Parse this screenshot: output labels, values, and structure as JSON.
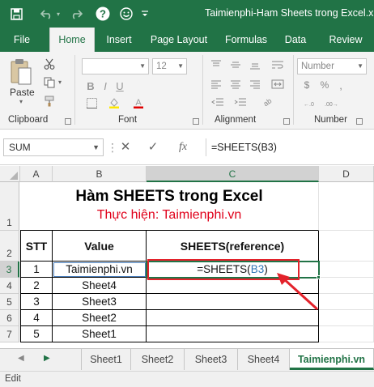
{
  "window": {
    "title": "Taimienphi-Ham Sheets trong Excel.xls"
  },
  "quick_access": {
    "save_icon": "save-icon",
    "undo_icon": "undo-icon",
    "redo_icon": "redo-icon",
    "help_glyph": "?",
    "smiley_icon": "smiley-icon",
    "more_icon": "more-icon"
  },
  "ribbon_tabs": [
    "File",
    "Home",
    "Insert",
    "Page Layout",
    "Formulas",
    "Data",
    "Review"
  ],
  "ribbon": {
    "paste_label": "Paste",
    "clipboard_label": "Clipboard",
    "font_label": "Font",
    "font_size": "12",
    "alignment_label": "Alignment",
    "number_label": "Number",
    "number_format": "Number",
    "currency_glyph": "$",
    "percent_glyph": "%"
  },
  "formula_bar": {
    "name_box": "SUM",
    "cancel_glyph": "✕",
    "enter_glyph": "✓",
    "fx_glyph": "fx",
    "formula": "=SHEETS(B3)"
  },
  "columns": [
    "A",
    "B",
    "C",
    "D"
  ],
  "rows": [
    "1",
    "2",
    "3",
    "4",
    "5",
    "6",
    "7"
  ],
  "sheet": {
    "title": "Hàm SHEETS trong Excel",
    "subtitle": "Thực hiện: Taimienphi.vn",
    "headers": {
      "stt": "STT",
      "value": "Value",
      "sheets": "SHEETS(reference)"
    },
    "data_rows": [
      {
        "stt": "1",
        "value": "Taimienphi.vn"
      },
      {
        "stt": "2",
        "value": "Sheet4"
      },
      {
        "stt": "3",
        "value": "Sheet3"
      },
      {
        "stt": "4",
        "value": "Sheet2"
      },
      {
        "stt": "5",
        "value": "Sheet1"
      }
    ],
    "editing_formula_prefix": "=SHEETS(",
    "editing_formula_ref": "B3",
    "editing_formula_suffix": ")"
  },
  "sheet_tabs": {
    "nav_prev": "◀",
    "nav_next": "▶",
    "tabs": [
      "Sheet1",
      "Sheet2",
      "Sheet3",
      "Sheet4",
      "Taimienphi.vn"
    ],
    "active": "Taimienphi.vn"
  },
  "status": {
    "mode": "Edit"
  },
  "colors": {
    "excel_green": "#217346",
    "annotation_red": "#e3222b",
    "ref_blue": "#2e75b6",
    "subtitle_red": "#e0001a"
  }
}
